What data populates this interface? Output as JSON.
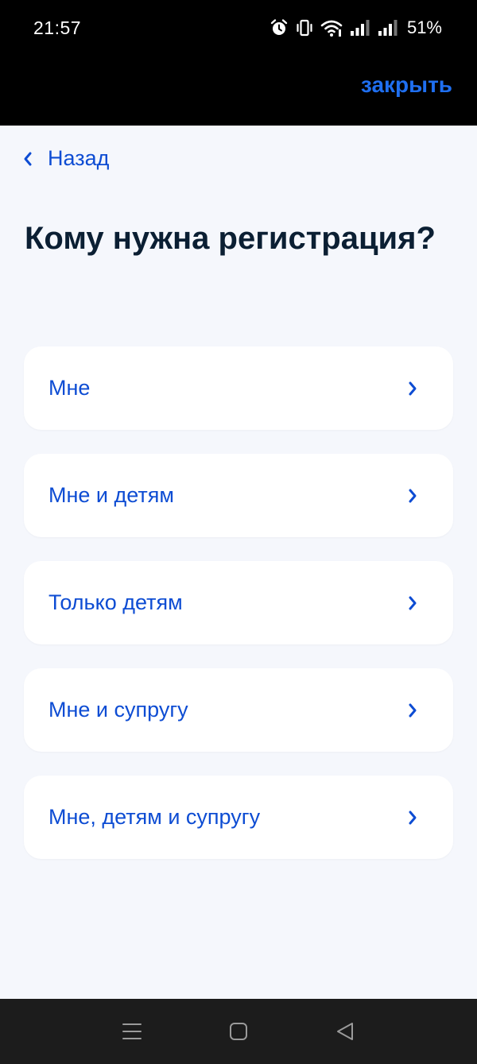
{
  "status_bar": {
    "time": "21:57",
    "battery": "51%",
    "icons": [
      "alarm-icon",
      "vibrate-icon",
      "wifi-icon",
      "signal-icon",
      "signal-icon"
    ]
  },
  "top_bar": {
    "close_label": "закрыть"
  },
  "back": {
    "label": "Назад"
  },
  "page": {
    "title": "Кому нужна регистрация?"
  },
  "options": [
    {
      "label": "Мне"
    },
    {
      "label": "Мне и детям"
    },
    {
      "label": "Только детям"
    },
    {
      "label": "Мне и супругу"
    },
    {
      "label": "Мне, детям и супругу"
    }
  ],
  "nav_bar": {
    "icons": [
      "menu-icon",
      "home-icon",
      "back-triangle-icon"
    ]
  },
  "colors": {
    "accent": "#0d4cd3",
    "close_link": "#1f6ff0",
    "title": "#0b1f33",
    "background": "#f5f7fc",
    "card": "#ffffff"
  }
}
